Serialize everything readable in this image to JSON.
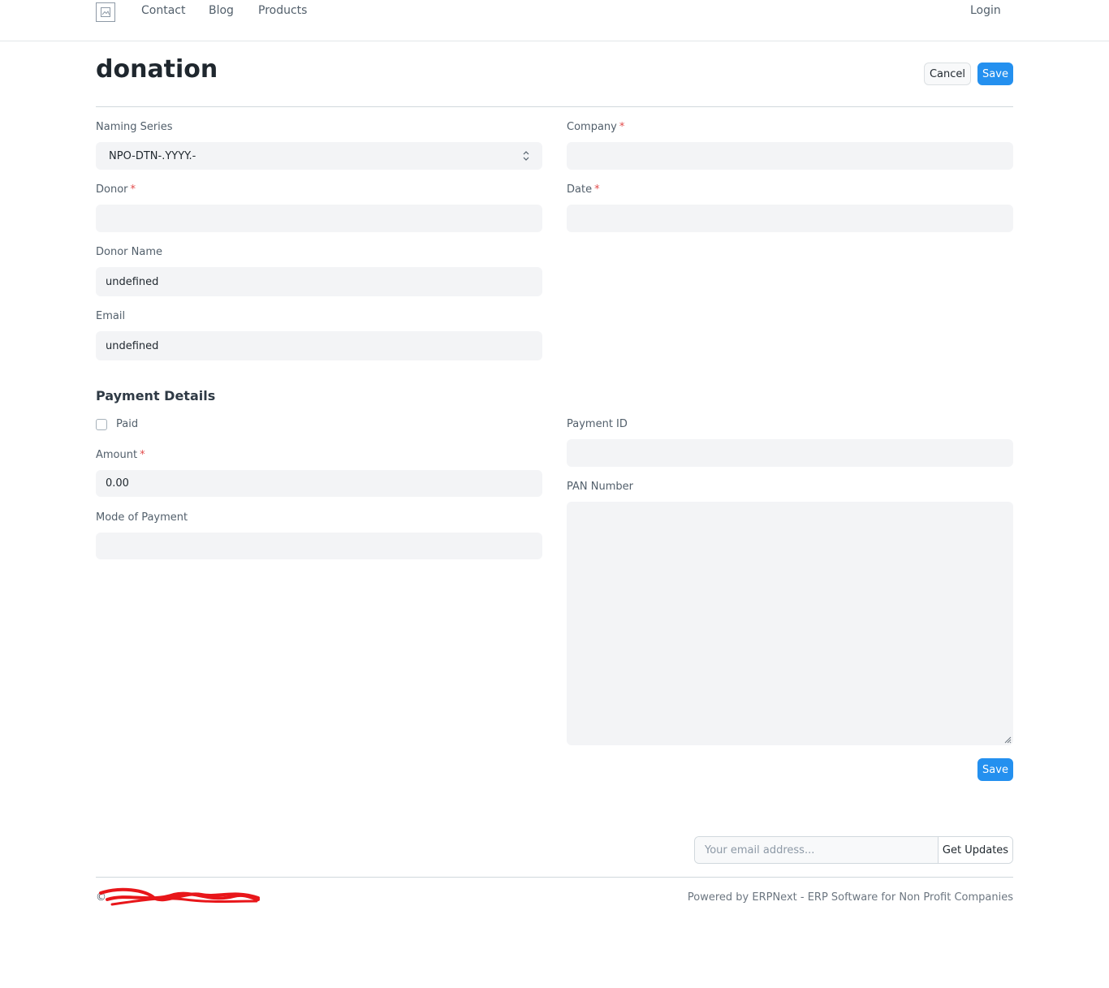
{
  "nav": {
    "links": [
      "Contact",
      "Blog",
      "Products"
    ],
    "login": "Login"
  },
  "page": {
    "title": "donation",
    "cancel_label": "Cancel",
    "save_label": "Save"
  },
  "form": {
    "naming_series": {
      "label": "Naming Series",
      "value": "NPO-DTN-.YYYY.-"
    },
    "company": {
      "label": "Company",
      "required_mark": "*",
      "value": ""
    },
    "donor": {
      "label": "Donor",
      "required_mark": "*",
      "value": ""
    },
    "date": {
      "label": "Date",
      "required_mark": "*",
      "value": ""
    },
    "donor_name": {
      "label": "Donor Name",
      "value": "undefined"
    },
    "email": {
      "label": "Email",
      "value": "undefined"
    }
  },
  "payment": {
    "section_title": "Payment Details",
    "paid": {
      "label": "Paid",
      "checked": false
    },
    "amount": {
      "label": "Amount",
      "required_mark": "*",
      "value": "0.00"
    },
    "mode_of_payment": {
      "label": "Mode of Payment",
      "value": ""
    },
    "payment_id": {
      "label": "Payment ID",
      "value": ""
    },
    "pan_number": {
      "label": "PAN Number",
      "value": ""
    },
    "save_label": "Save"
  },
  "footer": {
    "subscribe_placeholder": "Your email address...",
    "subscribe_button": "Get Updates",
    "copyright": "©",
    "powered_by": "Powered by ERPNext - ERP Software for Non Profit Companies"
  },
  "colors": {
    "primary": "#2490ef",
    "required": "#e24c4c",
    "redaction": "#e8161a"
  }
}
